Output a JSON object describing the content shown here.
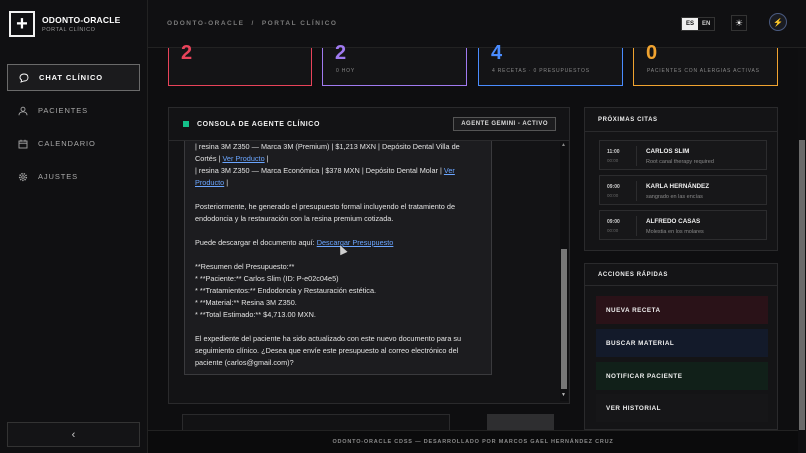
{
  "brand": {
    "title": "ODONTO-ORACLE",
    "subtitle": "PORTAL CLÍNICO"
  },
  "nav": [
    {
      "label": "CHAT CLÍNICO",
      "icon": "chat-icon",
      "active": true
    },
    {
      "label": "PACIENTES",
      "icon": "user-icon"
    },
    {
      "label": "CALENDARIO",
      "icon": "calendar-icon"
    },
    {
      "label": "AJUSTES",
      "icon": "gear-icon"
    }
  ],
  "collapse_icon": "chevron-left-icon",
  "header": {
    "breadcrumb_root": "ODONTO-ORACLE",
    "breadcrumb_separator": "/",
    "breadcrumb_page": "PORTAL CLÍNICO",
    "lang_es": "ES",
    "lang_en": "EN",
    "theme_icon": "sun-icon",
    "avatar_icon": "avatar-icon"
  },
  "stats": [
    {
      "value": "2",
      "label": "",
      "color": "#e8435a"
    },
    {
      "value": "2",
      "label": "0 HOY",
      "color": "#a07af0"
    },
    {
      "value": "4",
      "label": "4 RECETAS · 0 PRESUPUESTOS",
      "color": "#4a8cff"
    },
    {
      "value": "0",
      "label": "PACIENTES CON ALERGIAS ACTIVAS",
      "color": "#f0a330"
    }
  ],
  "console": {
    "title": "CONSOLA DE AGENTE CLÍNICO",
    "status_badge": "AGENTE GEMINI - ACTIVO",
    "status_color": "#14c08a",
    "lines": {
      "l1": "| resina 3M Z350 — Marca 3M (Premium) | $1,213 MXN | Depósito Dental Villa de",
      "l2a": "Cortés |",
      "l2link": "Ver Producto",
      "l2b": "|",
      "l3a": "| resina 3M Z350 — Marca Económica | $378 MXN | Depósito Dental Molar |",
      "l3link": "Ver",
      "l4link": "Producto",
      "l4b": "|",
      "p2a": "Posteriormente, he generado el presupuesto formal incluyendo el tratamiento de",
      "p2b": "endodoncia y la restauración con la resina premium cotizada.",
      "p3a": "Puede descargar el documento aquí:",
      "p3link": "Descargar Presupuesto",
      "r1": "**Resumen del Presupuesto:**",
      "r2": "* **Paciente:** Carlos Slim (ID: P-e02c04e5)",
      "r3": "* **Tratamientos:** Endodoncia y Restauración estética.",
      "r4": "* **Material:** Resina 3M Z350.",
      "r5": "* **Total Estimado:** $4,713.00 MXN.",
      "p5a": "El expediente del paciente ha sido actualizado con este nuevo documento para su",
      "p5b": "seguimiento clínico. ¿Desea que envíe este presupuesto al correo electrónico del",
      "p5c": "paciente (carlos@gmail.com)?"
    }
  },
  "appointments": {
    "title": "PRÓXIMAS CITAS",
    "items": [
      {
        "time": "11:00",
        "time2": "00:00",
        "name": "CARLOS SLIM",
        "note": "Root canal therapy required"
      },
      {
        "time": "09:00",
        "time2": "00:00",
        "name": "KARLA HERNÁNDEZ",
        "note": "sangrado en las encías"
      },
      {
        "time": "09:00",
        "time2": "00:00",
        "name": "ALFREDO CASAS",
        "note": "Molestia en los molares"
      }
    ]
  },
  "quick_actions": {
    "title": "ACCIONES RÁPIDAS",
    "items": [
      {
        "label": "NUEVA RECETA",
        "bg": "#2a1218"
      },
      {
        "label": "BUSCAR MATERIAL",
        "bg": "#131a2a"
      },
      {
        "label": "NOTIFICAR PACIENTE",
        "bg": "#112019"
      },
      {
        "label": "VER HISTORIAL",
        "bg": "#161618"
      }
    ]
  },
  "footer": "ODONTO-ORACLE CDSS — DESARROLLADO POR MARCOS GAEL HERNÁNDEZ CRUZ"
}
